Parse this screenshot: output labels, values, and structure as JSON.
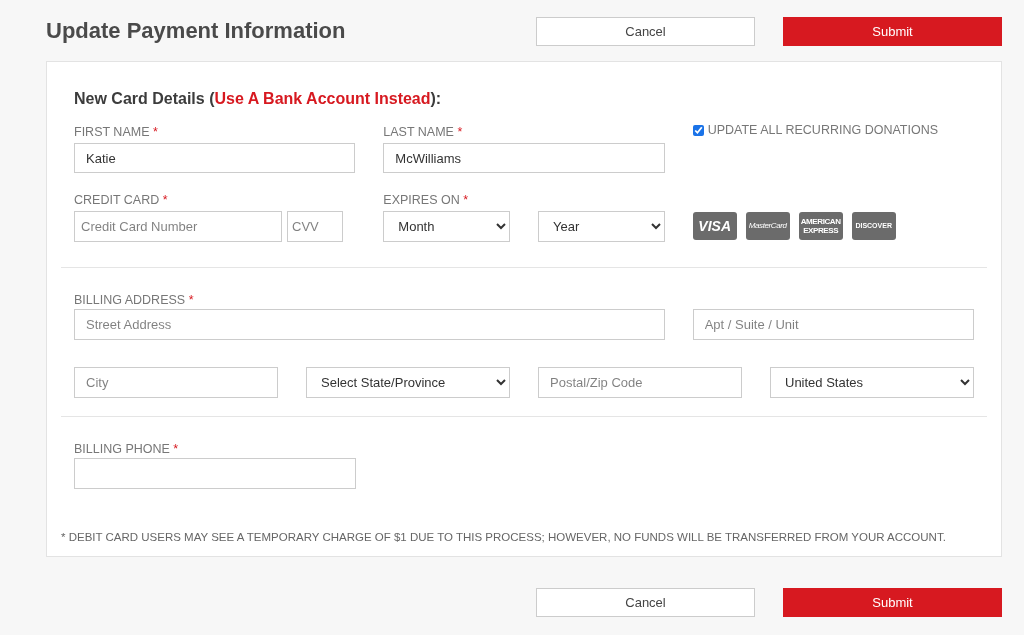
{
  "title": "Update Payment Information",
  "top_buttons": [
    {
      "label": "Cancel",
      "kind": "secondary"
    },
    {
      "label": "Submit",
      "kind": "primary"
    }
  ],
  "card_section": {
    "heading_before": "New Card Details (",
    "heading_link": "Use A Bank Account Instead",
    "heading_after": "):",
    "first_name": {
      "label": "FIRST NAME",
      "required_mark": "*",
      "value": "Katie"
    },
    "last_name": {
      "label": "LAST NAME",
      "required_mark": "*",
      "value": "McWilliams"
    },
    "update_recurring": {
      "label": "UPDATE ALL RECURRING DONATIONS",
      "checked": true
    },
    "credit_card": {
      "label": "CREDIT CARD",
      "required_mark": "*",
      "number_placeholder": "Credit Card Number",
      "cvv_placeholder": "CVV"
    },
    "expires_on": {
      "label": "EXPIRES ON",
      "required_mark": "*",
      "month": "Month",
      "year": "Year"
    },
    "card_logos": [
      {
        "kind": "visa",
        "text": "VISA"
      },
      {
        "kind": "mastercard",
        "text": "MasterCard"
      },
      {
        "kind": "amex",
        "text": "AMERICAN EXPRESS"
      },
      {
        "kind": "discover",
        "text": "DISCOVER"
      }
    ]
  },
  "billing_address": {
    "label": "BILLING ADDRESS",
    "required_mark": "*",
    "street_placeholder": "Street Address",
    "apt_placeholder": "Apt / Suite / Unit",
    "city_placeholder": "City",
    "state": "Select State/Province",
    "zip_placeholder": "Postal/Zip Code",
    "country": "United States"
  },
  "billing_phone": {
    "label": "BILLING PHONE",
    "required_mark": "*"
  },
  "footnote": "* DEBIT CARD USERS MAY SEE A TEMPORARY CHARGE OF $1 DUE TO THIS PROCESS; HOWEVER, NO FUNDS WILL BE TRANSFERRED FROM YOUR ACCOUNT.",
  "bottom_buttons": [
    {
      "label": "Cancel",
      "kind": "secondary"
    },
    {
      "label": "Submit",
      "kind": "primary"
    }
  ]
}
